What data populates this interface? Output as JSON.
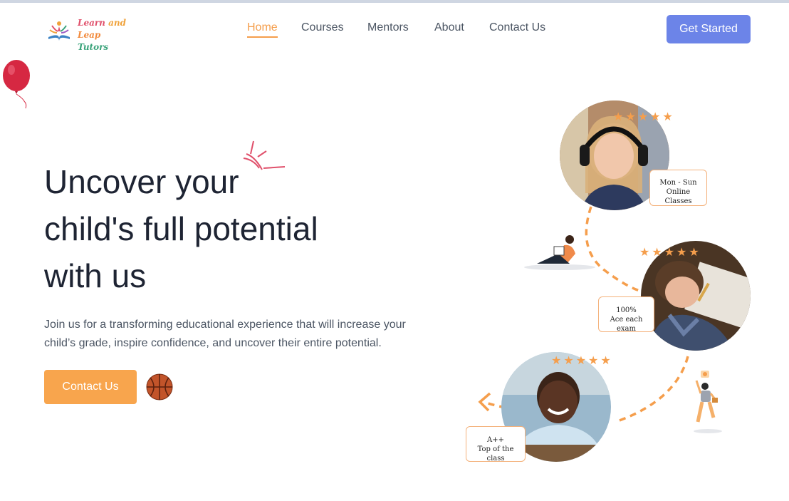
{
  "brand": {
    "line1_a": "Learn",
    "line1_b": "and",
    "line2_a": "Leap",
    "line2_b": "Tutors"
  },
  "nav": {
    "items": [
      "Home",
      "Courses",
      "Mentors",
      "About",
      "Contact Us"
    ],
    "active": "Home"
  },
  "header": {
    "cta_label": "Get Started"
  },
  "hero": {
    "title_line1": "Uncover your",
    "title_line2": "child's full potential",
    "title_line3": "with us",
    "description_line1": "Join us for a transforming educational experience that will increase your",
    "description_line2": "child’s grade, inspire confidence, and uncover their entire potential.",
    "contact_label": "Contact Us"
  },
  "cards": [
    {
      "line1": "Mon - Sun",
      "line2": "Online Classes",
      "rating": 5
    },
    {
      "line1": "100%",
      "line2": "Ace each exam",
      "rating": 5
    },
    {
      "line1": "A++",
      "line2": "Top of the class",
      "rating": 5
    }
  ],
  "colors": {
    "accent": "#f59e4c",
    "primary": "#6c84e8",
    "text": "#1e2433",
    "muted": "#4b5563"
  }
}
